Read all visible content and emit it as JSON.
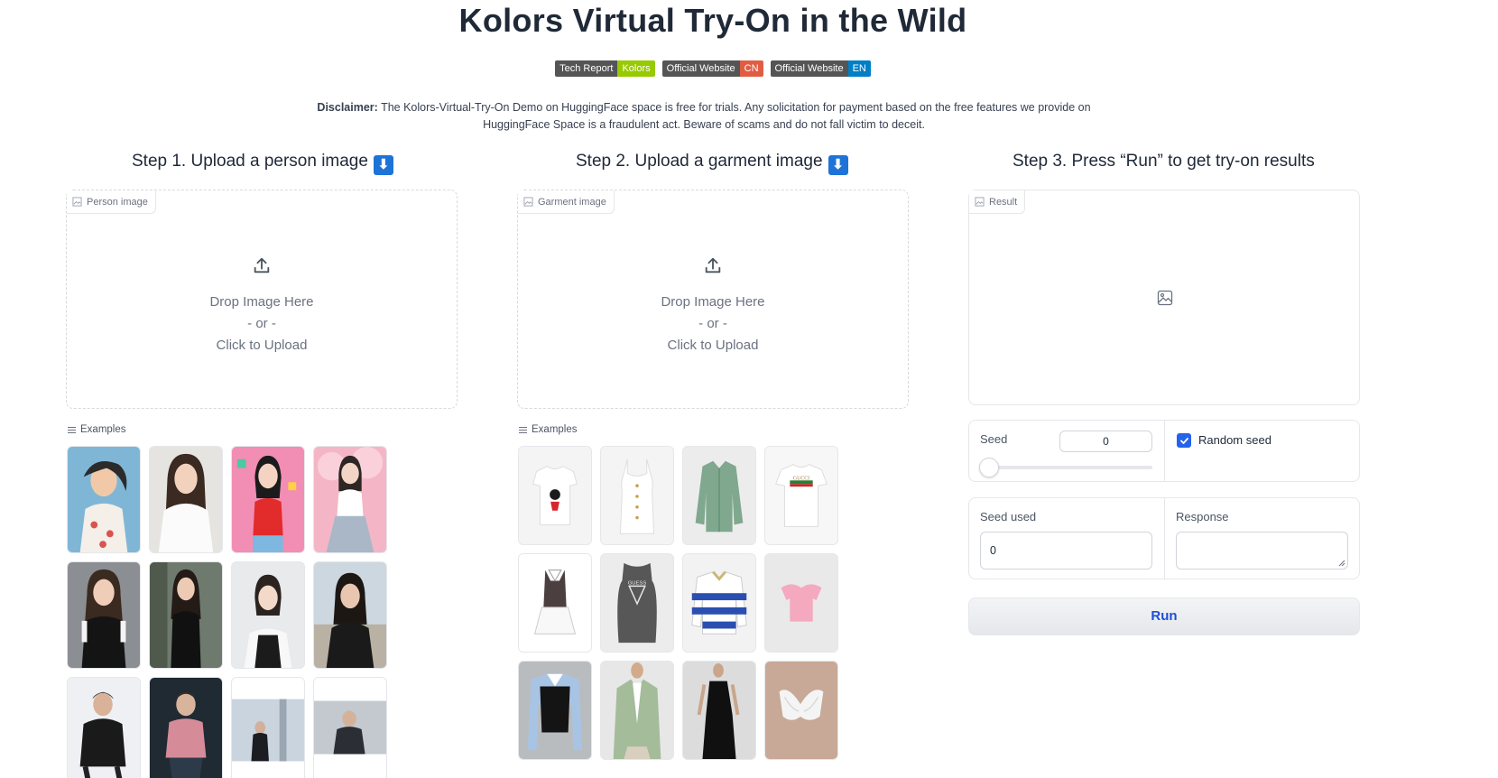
{
  "title": "Kolors Virtual Try-On in the Wild",
  "badges": [
    {
      "left": "Tech Report",
      "right": "Kolors",
      "color": "#97ca00"
    },
    {
      "left": "Official Website",
      "right": "CN",
      "color": "#e05d44"
    },
    {
      "left": "Official Website",
      "right": "EN",
      "color": "#007ec6"
    }
  ],
  "disclaimer": {
    "label": "Disclaimer:",
    "text": " The Kolors-Virtual-Try-On Demo on HuggingFace space is free for trials. Any solicitation for payment based on the free features we provide on HuggingFace Space is a fraudulent act. Beware of scams and do not fall victim to deceit."
  },
  "steps": {
    "step1": "Step 1. Upload a person image",
    "step2": "Step 2. Upload a garment image",
    "step3": "Step 3. Press “Run” to get try-on results",
    "arrow_icon": "⬇"
  },
  "person_upload": {
    "label": "Person image",
    "drop": "Drop Image Here",
    "or": "- or -",
    "click": "Click to Upload"
  },
  "garment_upload": {
    "label": "Garment image",
    "drop": "Drop Image Here",
    "or": "- or -",
    "click": "Click to Upload"
  },
  "result": {
    "label": "Result"
  },
  "examples_label": "Examples",
  "person_examples": [
    "woman-floral-top",
    "woman-white-blouse",
    "woman-red-top-pink-bg",
    "woman-pink-clouds",
    "woman-black-top-city",
    "woman-black-dress",
    "woman-white-tee",
    "woman-black-sweater-beach",
    "man-leather-jacket",
    "man-pink-shirt",
    "man-suit-rocket",
    "man-office"
  ],
  "garment_examples": [
    "minnie-tee",
    "white-cami",
    "green-denim-jacket",
    "gucci-tee",
    "mini-dress",
    "guess-tank",
    "striped-rugby",
    "pink-crop-top",
    "vest-shirt-combo",
    "green-blazer",
    "black-slip-dress",
    "lace-bralette"
  ],
  "seed": {
    "label": "Seed",
    "value": "0",
    "random_label": "Random seed",
    "random_checked": true
  },
  "seed_used": {
    "label": "Seed used",
    "value": "0"
  },
  "response": {
    "label": "Response",
    "value": ""
  },
  "run_label": "Run"
}
